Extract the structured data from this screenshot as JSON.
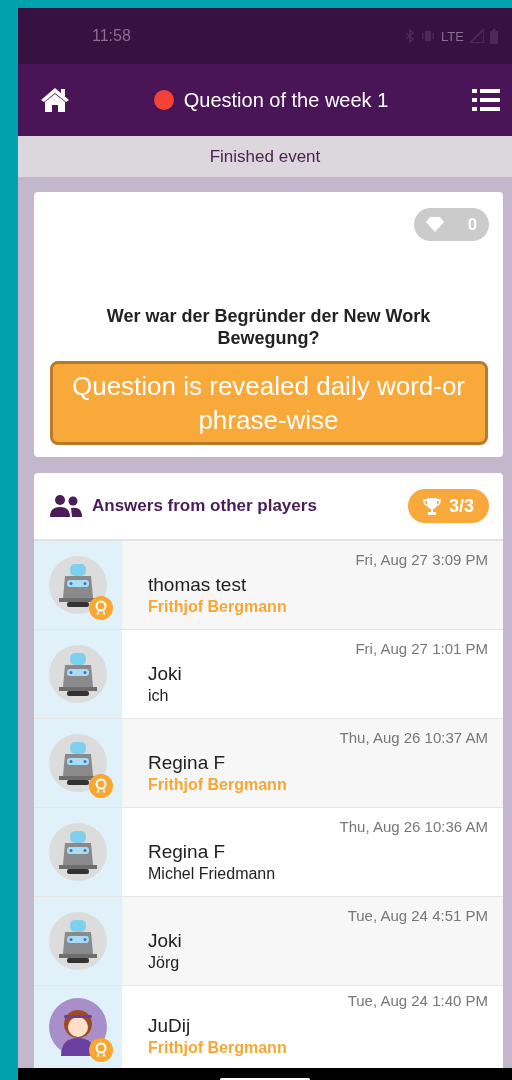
{
  "status_bar": {
    "time": "11:58",
    "network": "LTE"
  },
  "header": {
    "title": "Question of the week 1",
    "live": false
  },
  "event_banner": "Finished event",
  "question_card": {
    "gems": "0",
    "question": "Wer war der Begründer der New Work Bewegung?",
    "annotation": "Question is revealed daily word-or phrase-wise"
  },
  "answers": {
    "title": "Answers from other players",
    "score": "3/3",
    "rows": [
      {
        "kind": "robot",
        "correct": true,
        "name": "thomas test",
        "answer": "Frithjof Bergmann",
        "time": "Fri, Aug 27 3:09 PM"
      },
      {
        "kind": "robot",
        "correct": false,
        "name": "Joki",
        "answer": "ich",
        "time": "Fri, Aug 27 1:01 PM"
      },
      {
        "kind": "robot",
        "correct": true,
        "name": "Regina F",
        "answer": "Frithjof Bergmann",
        "time": "Thu, Aug 26 10:37 AM"
      },
      {
        "kind": "robot",
        "correct": false,
        "name": "Regina F",
        "answer": "Michel Friedmann",
        "time": "Thu, Aug 26 10:36 AM"
      },
      {
        "kind": "robot",
        "correct": false,
        "name": "Joki",
        "answer": "Jörg",
        "time": "Tue, Aug 24 4:51 PM"
      },
      {
        "kind": "girl",
        "correct": true,
        "name": "JuDij",
        "answer": "Frithjof Bergmann",
        "time": "Tue, Aug 24 1:40 PM"
      }
    ]
  }
}
